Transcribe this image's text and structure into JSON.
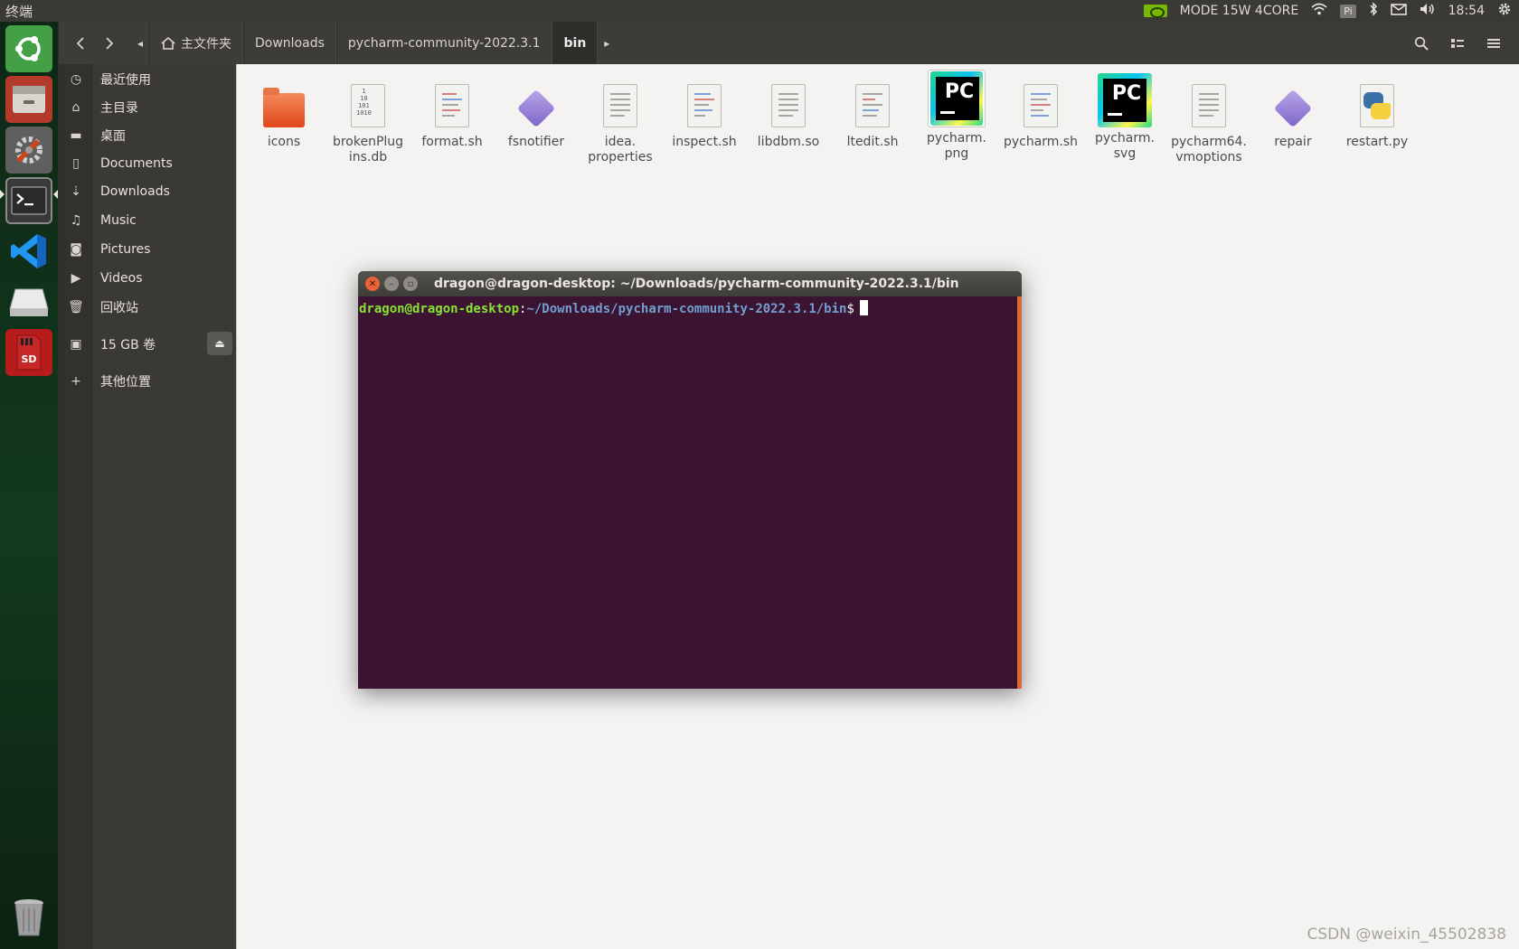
{
  "top_panel": {
    "app_title": "终端",
    "mode": "MODE 15W 4CORE",
    "pi_label": "Pi",
    "time": "18:54"
  },
  "launcher": {
    "items": [
      {
        "name": "ubuntu-dash-icon",
        "color": "#3fa152"
      },
      {
        "name": "files-icon",
        "color": "#c0392b"
      },
      {
        "name": "system-settings-icon",
        "color": "#6d6d6d"
      },
      {
        "name": "terminal-icon",
        "color": "#2c2c2c"
      },
      {
        "name": "vscode-icon",
        "color": "#1e88e5"
      },
      {
        "name": "drive-icon",
        "color": "#d8d8d8"
      },
      {
        "name": "sd-card-icon",
        "color": "#c62828"
      },
      {
        "name": "trash-icon",
        "color": "#9e9e9e"
      }
    ],
    "sd_label": "SD"
  },
  "file_manager": {
    "breadcrumbs": [
      "主文件夹",
      "Downloads",
      "pycharm-community-2022.3.1",
      "bin"
    ],
    "sidebar": [
      {
        "icon": "recent-icon",
        "label": "最近使用"
      },
      {
        "icon": "home-icon",
        "label": "主目录"
      },
      {
        "icon": "desktop-icon",
        "label": "桌面"
      },
      {
        "icon": "documents-icon",
        "label": "Documents"
      },
      {
        "icon": "downloads-icon",
        "label": "Downloads"
      },
      {
        "icon": "music-icon",
        "label": "Music"
      },
      {
        "icon": "pictures-icon",
        "label": "Pictures"
      },
      {
        "icon": "videos-icon",
        "label": "Videos"
      },
      {
        "icon": "trash-icon",
        "label": "回收站"
      },
      {
        "icon": "volume-icon",
        "label": "15 GB 卷"
      },
      {
        "icon": "plus-icon",
        "label": "其他位置"
      }
    ],
    "files": [
      {
        "name": "icons",
        "type": "folder"
      },
      {
        "name": "brokenPlug\nins.db",
        "type": "binary"
      },
      {
        "name": "format.sh",
        "type": "script"
      },
      {
        "name": "fsnotifier",
        "type": "executable"
      },
      {
        "name": "idea.\nproperties",
        "type": "text"
      },
      {
        "name": "inspect.sh",
        "type": "script"
      },
      {
        "name": "libdbm.so",
        "type": "text"
      },
      {
        "name": "ltedit.sh",
        "type": "script"
      },
      {
        "name": "pycharm.\npng",
        "type": "pycharm-image"
      },
      {
        "name": "pycharm.sh",
        "type": "script"
      },
      {
        "name": "pycharm.\nsvg",
        "type": "pycharm-image"
      },
      {
        "name": "pycharm64.\nvmoptions",
        "type": "text"
      },
      {
        "name": "repair",
        "type": "executable"
      },
      {
        "name": "restart.py",
        "type": "python"
      }
    ],
    "binary_icon_text": "1\n10\n101\n1010",
    "pc_logo_text": "PC"
  },
  "terminal": {
    "title": "dragon@dragon-desktop: ~/Downloads/pycharm-community-2022.3.1/bin",
    "prompt_user": "dragon@dragon-desktop",
    "prompt_sep": ":",
    "prompt_path": "~/Downloads/pycharm-community-2022.3.1/bin",
    "prompt_dollar": "$"
  },
  "watermark": "CSDN @weixin_45502838"
}
